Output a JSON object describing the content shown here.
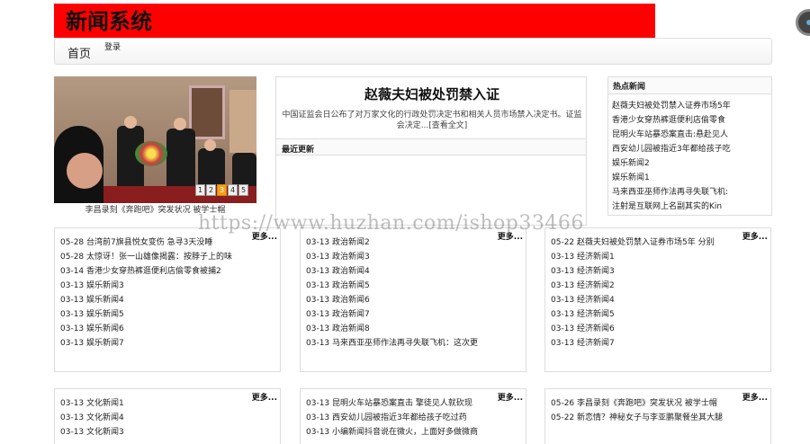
{
  "header": {
    "title": "新闻系统"
  },
  "nav": {
    "home": "首页",
    "login": "登录"
  },
  "slideshow": {
    "caption": "李昌录刻《奔跑吧》突发状况 被学士帽",
    "pages": [
      "1",
      "2",
      "3",
      "4",
      "5"
    ],
    "active_page": "3"
  },
  "featured": {
    "title": "赵薇夫妇被处罚禁入证",
    "summary": "中国证监会日公布了对万家文化的行政处罚决定书和相关人员市场禁入决定书。证监会决定...[查看全文]",
    "latest_label": "最近更新"
  },
  "hot": {
    "title": "热点新闻",
    "items": [
      "赵薇夫妇被处罚禁入证券市场5年",
      "香港少女穿热裤逛便利店偷零食",
      "昆明火车站暴恐案直击:悬赴见人",
      "西安幼儿园被指近3年都给孩子吃",
      "娱乐新闻2",
      "娱乐新闻1",
      "马来西亚巫师作法再寻失联飞机:",
      "注射是互联网上名副其实的Kin"
    ]
  },
  "boxes": [
    {
      "more": "更多...",
      "items": [
        "05-28 台湾前7旗县悦女变伤 急寻3天没睡",
        "05-28 太惊讶！张一山雄像揭露：按脖子上的味",
        "03-14 香港少女穿热裤逛便利店偷零食被捕2",
        "03-13 娱乐新闻3",
        "03-13 娱乐新闻4",
        "03-13 娱乐新闻5",
        "03-13 娱乐新闻6",
        "03-13 娱乐新闻7"
      ]
    },
    {
      "more": "更多...",
      "items": [
        "03-13 政治新闻2",
        "03-13 政治新闻3",
        "03-13 政治新闻4",
        "03-13 政治新闻5",
        "03-13 政治新闻6",
        "03-13 政治新闻7",
        "03-13 政治新闻8",
        "03-13 马来西亚巫师作法再寻失联飞机：这次更"
      ]
    },
    {
      "more": "更多...",
      "items": [
        "05-22 赵薇夫妇被处罚禁入证券市场5年 分别",
        "03-13 经济新闻1",
        "03-13 经济新闻3",
        "03-13 经济新闻2",
        "03-13 经济新闻4",
        "03-13 经济新闻5",
        "03-13 经济新闻6",
        "03-13 经济新闻7"
      ]
    },
    {
      "more": "更多...",
      "items": [
        "03-13 文化新闻1",
        "03-13 文化新闻4",
        "03-13 文化新闻3"
      ]
    },
    {
      "more": "更多...",
      "items": [
        "03-13 昆明火车站暴恐案直击 擎徒见人就砍现",
        "03-13 西安幼儿园被指近3年都给孩子吃过药",
        "03-13 小编新闻抖音说在微火，上面好多做微商"
      ]
    },
    {
      "more": "更多...",
      "items": [
        "05-26 李昌录刻《奔跑吧》突发状况 被学士帽",
        "05-22 新恋情？神秘女子与李亚鹏聚餐坐其大腿"
      ]
    }
  ],
  "watermark": "https://www.huzhan.com/ishop33466"
}
